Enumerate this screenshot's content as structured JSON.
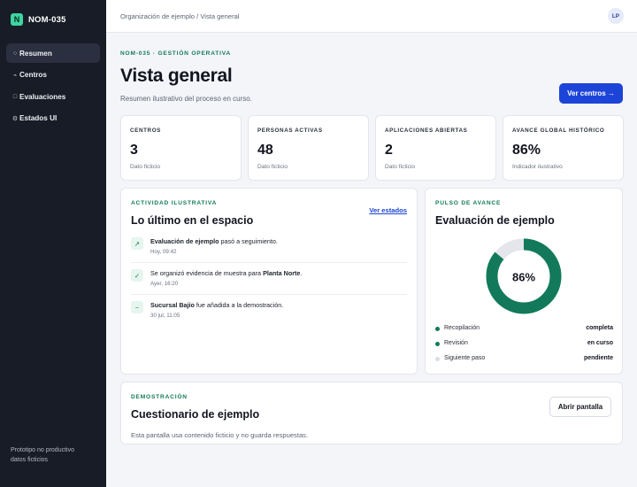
{
  "sidebar": {
    "brand_logo": "N",
    "brand_name": "NOM-035",
    "items": [
      {
        "label": "Resumen",
        "icon": "○",
        "active": true
      },
      {
        "label": "Centros",
        "icon": "⌁"
      },
      {
        "label": "Evaluaciones",
        "icon": "□"
      },
      {
        "label": "Estados UI",
        "icon": "⚙"
      }
    ],
    "footer_line1": "Prototipo no productivo",
    "footer_line2": "datos ficticios"
  },
  "topbar": {
    "breadcrumb": "Organización de ejemplo / Vista general",
    "avatar_initials": "LP"
  },
  "page": {
    "eyebrow": "NOM-035 · GESTIÓN OPERATIVA",
    "title": "Vista general",
    "subtitle": "Resumen ilustrativo del proceso en curso.",
    "primary_button": "Ver centros →"
  },
  "stats": [
    {
      "label": "CENTROS",
      "value": "3",
      "note": "Dato ficticio"
    },
    {
      "label": "PERSONAS ACTIVAS",
      "value": "48",
      "note": "Dato ficticio"
    },
    {
      "label": "APLICACIONES ABIERTAS",
      "value": "2",
      "note": "Dato ficticio"
    },
    {
      "label": "AVANCE GLOBAL HISTÓRICO",
      "value": "86%",
      "note": "Indicador ilustrativo"
    }
  ],
  "activity": {
    "eyebrow": "ACTIVIDAD ILUSTRATIVA",
    "title": "Lo último en el espacio",
    "link": "Ver estados",
    "items": [
      {
        "icon": "↗",
        "strong": "Evaluación de ejemplo",
        "text": " pasó a seguimiento.",
        "time": "Hoy, 09:42"
      },
      {
        "icon": "✓",
        "prefix": "Se organizó evidencia de muestra para ",
        "strong": "Planta Norte",
        "text": ".",
        "time": "Ayer, 16:20"
      },
      {
        "icon": "~",
        "strong": "Sucursal Bajío",
        "text": " fue añadida a la demostración.",
        "time": "30 jul, 11:05"
      }
    ]
  },
  "progress": {
    "eyebrow": "PULSO DE AVANCE",
    "title": "Evaluación de ejemplo",
    "percent": 86,
    "percent_label": "86%",
    "color_done": "#127a5a",
    "color_track": "#e4e6ec",
    "legend": [
      {
        "name": "Recopilación",
        "status": "completa",
        "color": "#127a5a"
      },
      {
        "name": "Revisión",
        "status": "en curso",
        "color": "#127a5a"
      },
      {
        "name": "Siguiente paso",
        "status": "pendiente",
        "color": "#d9dce3"
      }
    ]
  },
  "demo": {
    "eyebrow": "DEMOSTRACIÓN",
    "title": "Cuestionario de ejemplo",
    "description": "Esta pantalla usa contenido ficticio y no guarda respuestas.",
    "button": "Abrir pantalla"
  }
}
